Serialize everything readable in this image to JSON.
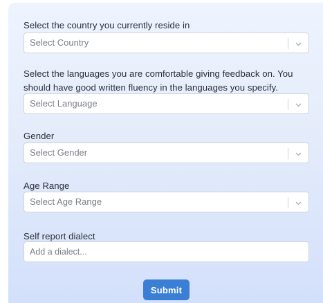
{
  "form": {
    "country": {
      "label": "Select the country you currently reside in",
      "placeholder": "Select Country"
    },
    "languages": {
      "label": "Select the languages you are comfortable giving feedback on. You should have good written fluency in the languages you specify.",
      "placeholder": "Select Language"
    },
    "gender": {
      "label": "Gender",
      "placeholder": "Select Gender"
    },
    "age_range": {
      "label": "Age Range",
      "placeholder": "Select Age Range"
    },
    "dialect": {
      "label": "Self report dialect",
      "placeholder": "Add a dialect...",
      "value": ""
    },
    "submit_label": "Submit"
  },
  "icons": {
    "dropdown": "chevron-down-icon"
  },
  "colors": {
    "accent": "#3a7fd5",
    "panel_top": "#eef4fe",
    "panel_bottom": "#d3e0fb"
  }
}
